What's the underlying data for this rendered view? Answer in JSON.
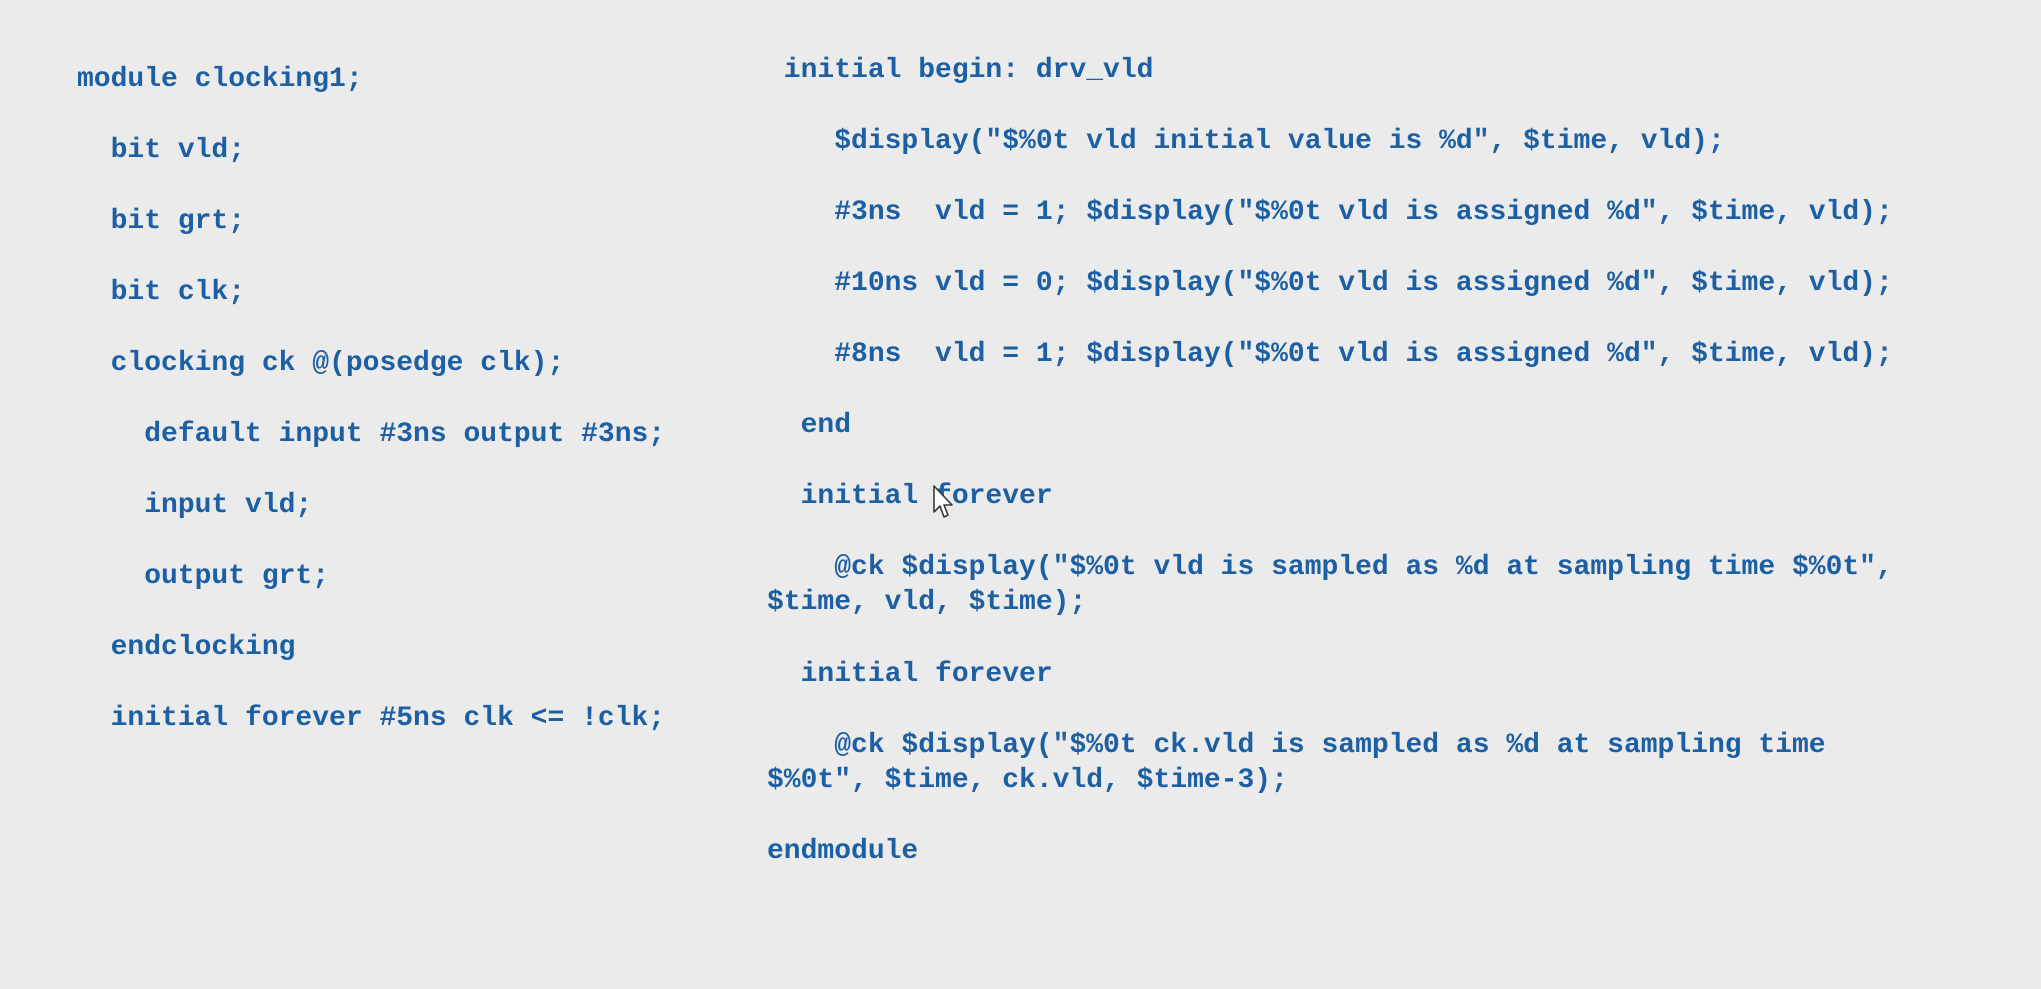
{
  "left_code": [
    "module clocking1;",
    "  bit vld;",
    "  bit grt;",
    "  bit clk;",
    "  clocking ck @(posedge clk);",
    "    default input #3ns output #3ns;",
    "    input vld;",
    "    output grt;",
    "  endclocking",
    "  initial forever #5ns clk <= !clk;"
  ],
  "right_code": [
    " initial begin: drv_vld",
    "    $display(\"$%0t vld initial value is %d\", $time, vld);",
    "    #3ns  vld = 1; $display(\"$%0t vld is assigned %d\", $time, vld);",
    "    #10ns vld = 0; $display(\"$%0t vld is assigned %d\", $time, vld);",
    "    #8ns  vld = 1; $display(\"$%0t vld is assigned %d\", $time, vld);",
    "  end",
    "  initial forever",
    "    @ck $display(\"$%0t vld is sampled as %d at sampling time $%0t\",",
    "$time, vld, $time);",
    "  initial forever",
    "    @ck $display(\"$%0t ck.vld is sampled as %d at sampling time",
    "$%0t\", $time, ck.vld, $time-3);",
    "endmodule"
  ]
}
